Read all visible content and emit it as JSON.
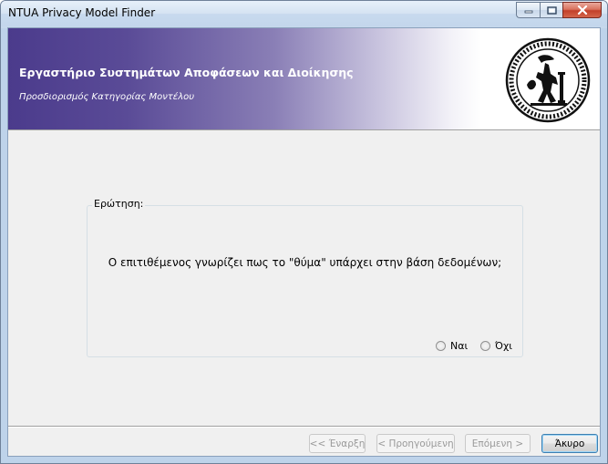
{
  "window": {
    "title": "NTUA Privacy Model Finder"
  },
  "banner": {
    "title": "Εργαστήριο Συστημάτων Αποφάσεων και Διοίκησης",
    "subtitle": "Προσδιορισμός Κατηγορίας Μοντέλου",
    "logo_icon": "ntua-seal-logo"
  },
  "question": {
    "group_label": "Ερώτηση:",
    "text": "Ο επιτιθέμενος γνωρίζει πως το \"θύμα\" υπάρχει στην βάση δεδομένων;",
    "options": [
      {
        "label": "Ναι",
        "selected": false
      },
      {
        "label": "Όχι",
        "selected": false
      }
    ]
  },
  "buttons": {
    "start": {
      "label": "<< Έναρξη",
      "enabled": false
    },
    "previous": {
      "label": "< Προηγούμενη",
      "enabled": false
    },
    "next": {
      "label": "Επόμενη >",
      "enabled": false
    },
    "cancel": {
      "label": "Άκυρο",
      "enabled": true
    }
  },
  "colors": {
    "banner_start": "#4b3b8c",
    "close_button": "#c3402a"
  }
}
